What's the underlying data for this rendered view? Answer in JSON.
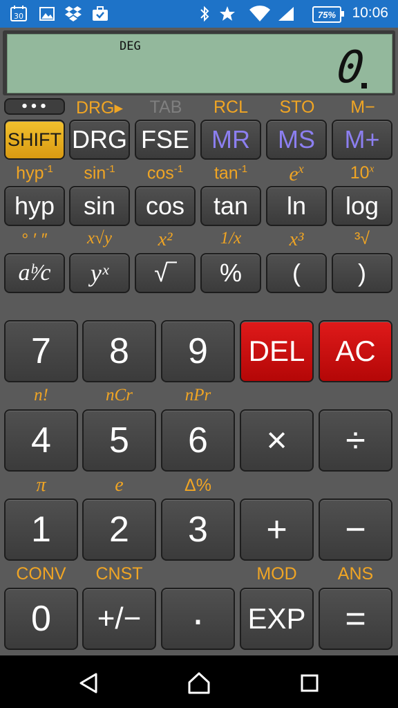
{
  "status_bar": {
    "time": "10:06",
    "battery": "75%",
    "icons": [
      "calendar-icon",
      "gallery-icon",
      "dropbox-icon",
      "briefcase-icon",
      "bluetooth-icon",
      "star-icon",
      "wifi-icon",
      "signal-icon"
    ],
    "calendar_day": "30",
    "color": "#1e73c8"
  },
  "display": {
    "mode": "DEG",
    "value": "0"
  },
  "menu_button": "•••",
  "row1_labels": [
    "DRG▸",
    "TAB",
    "RCL",
    "STO",
    "M−"
  ],
  "row1_keys": [
    "SHIFT",
    "DRG",
    "FSE",
    "MR",
    "MS",
    "M+"
  ],
  "row2_labels": {
    "hyp": "hyp",
    "hyp_sup": "-1",
    "sin": "sin",
    "sin_sup": "-1",
    "cos": "cos",
    "cos_sup": "-1",
    "tan": "tan",
    "tan_sup": "-1",
    "ex": "e",
    "ex_sup": "x",
    "tenx": "10",
    "tenx_sup": "x"
  },
  "row2_keys": [
    "hyp",
    "sin",
    "cos",
    "tan",
    "ln",
    "log"
  ],
  "row3_labels": {
    "dms": "° ′ ″",
    "xrooty": "x√y",
    "xsq": "x²",
    "inv": "1/x",
    "xcube": "x³",
    "cuberoot": "³√"
  },
  "row3_keys": [
    "aᵇ⁄c",
    "yˣ",
    "√‾",
    "%",
    "(",
    ")"
  ],
  "num_labels": {
    "factorial": "n!",
    "ncr": "nCr",
    "npr": "nPr",
    "pi": "π",
    "e": "e",
    "delta_pct": "Δ%",
    "conv": "CONV",
    "cnst": "CNST",
    "mod": "MOD",
    "ans": "ANS"
  },
  "num_keys": {
    "row1": [
      "7",
      "8",
      "9",
      "DEL",
      "AC"
    ],
    "row2": [
      "4",
      "5",
      "6",
      "×",
      "÷"
    ],
    "row3": [
      "1",
      "2",
      "3",
      "+",
      "−"
    ],
    "row4": [
      "0",
      "+/−",
      "·",
      "EXP",
      "="
    ]
  },
  "colors": {
    "label": "#f0a524",
    "shift": "#f2c12e",
    "red": "#d01010",
    "memory": "#8c7ff0",
    "display": "#93b89c"
  }
}
